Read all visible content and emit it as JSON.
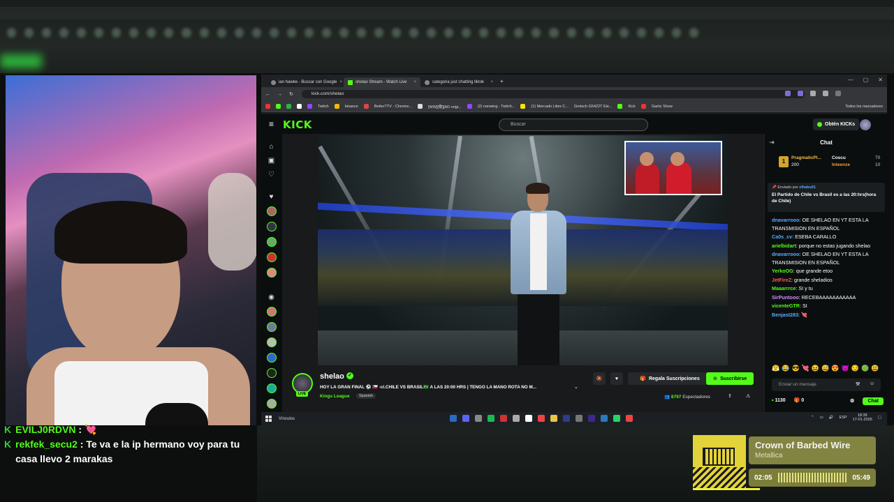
{
  "browser": {
    "tabs": [
      {
        "label": "ian hawke - Buscar con Google",
        "active": false
      },
      {
        "label": "shelao Stream - Watch Live",
        "active": true
      },
      {
        "label": "categoria just chatting tiktok",
        "active": false
      }
    ],
    "url": "kick.com/shelao",
    "bookmarks": [
      "Twitch",
      "binance",
      "BetterTTV - Chrome...",
      "[WW][歌][AD origi...",
      "(2) nonwing - Twitch...",
      "(1) Mercado Libre C...",
      "Gretsch G5422T Ele...",
      "Kick",
      "Gartic Show",
      "Todos los marcadores"
    ]
  },
  "kick": {
    "logo": "KICK",
    "search_placeholder": "Buscar",
    "get_kicks_label": "Obtén KICKs",
    "streamer": {
      "name": "shelao",
      "live_label": "LIVE",
      "title": "HOY LA GRAN FINAL ⚽ 🇨🇱 -cl.CHILE VS BRASIL🇧🇷 A LAS 20:00 HRS | TENGO LA MANO ROTA NO M...",
      "category": "Kings League",
      "tag": "Spanish",
      "viewers": "8797",
      "viewers_label": "Espectadores"
    },
    "gift_subs_label": "Regala Suscripciones",
    "subscribe_label": "Suscribirse"
  },
  "chat": {
    "title": "Chat",
    "top_gifters": [
      {
        "rank": "1",
        "name": "PragmaticPl...",
        "amount": "200"
      },
      {
        "name": "Coscu",
        "amount": "70"
      },
      {
        "name": "Inteenze",
        "amount": "10"
      }
    ],
    "pinned": {
      "sent_by_label": "Enviado por",
      "sent_by_user": "elhaku01",
      "text": "El Partido de Chile vs Brasil es a las 20:hrs(hora de Chile)"
    },
    "messages": [
      {
        "user": "dnavarrooo",
        "color": "#5aa9ff",
        "text": "OE SHELAO EN YT ESTA LA TRANSMISION EN ESPAÑOL"
      },
      {
        "user": "Ca0s_cv",
        "color": "#5aa9ff",
        "text": "ESEBA CARALLO"
      },
      {
        "user": "arielbidart",
        "color": "#53fc18",
        "text": "porque no estas jugando shelao"
      },
      {
        "user": "dnavarrooo",
        "color": "#5aa9ff",
        "text": "OE SHELAO EN YT ESTA LA TRANSMISION EN ESPAÑOL"
      },
      {
        "user": "YerkoOG",
        "color": "#53fc18",
        "text": "que grande etoo"
      },
      {
        "user": "JetFireZ",
        "color": "#ff5a5a",
        "text": "grande sheladios"
      },
      {
        "user": "Maaarrrce",
        "color": "#53fc18",
        "text": "SI y tu"
      },
      {
        "user": "SirPuntooo",
        "color": "#d08cff",
        "text": "RECEBAAAAAAAAAAA"
      },
      {
        "user": "vicenteGTR",
        "color": "#53fc18",
        "text": "SI"
      },
      {
        "user": "Benjast283",
        "color": "#5aa9ff",
        "text": "💘"
      }
    ],
    "input_placeholder": "Enviar un mensaje",
    "points": "1130",
    "gift_count": "0",
    "send_label": "Chat"
  },
  "overlay_chat": [
    {
      "user": "EVILJ0RDVN",
      "text": "💘"
    },
    {
      "user": "rekfek_secu2",
      "text": "Te va e la ip hermano voy para tu casa llevo 2 marakas"
    }
  ],
  "taskbar": {
    "vinculos": "Vínculos",
    "lang": "ESP",
    "time": "18:39",
    "date": "17-01-2026"
  },
  "now_playing": {
    "title": "Crown of Barbed Wire",
    "artist": "Metallica",
    "elapsed": "02:05",
    "duration": "05:49"
  }
}
